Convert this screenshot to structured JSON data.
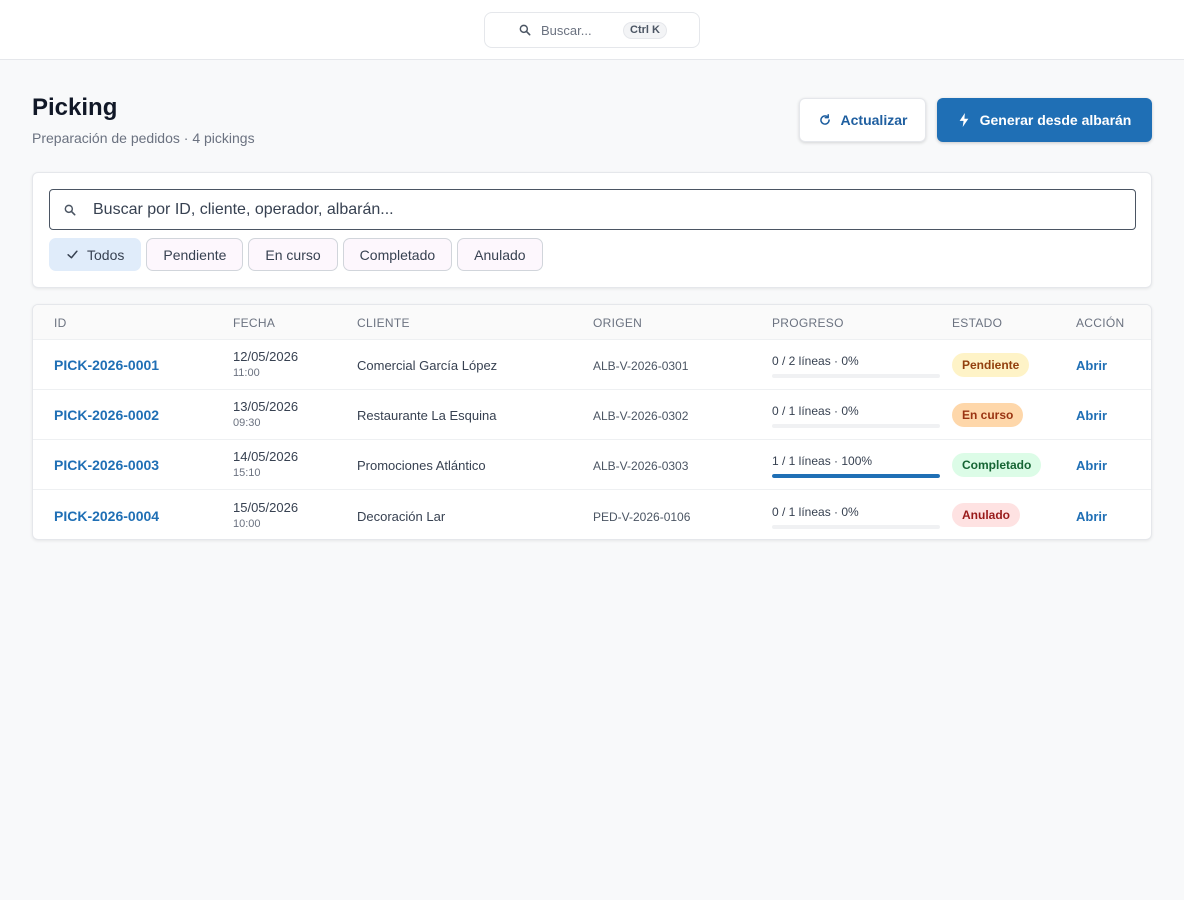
{
  "topbar": {
    "search_placeholder": "Buscar...",
    "shortcut": "Ctrl K"
  },
  "header": {
    "title": "Picking",
    "subtitle": "Preparación de pedidos · 4 pickings",
    "refresh_label": "Actualizar",
    "generate_label": "Generar desde albarán"
  },
  "filters": {
    "search_placeholder": "Buscar por ID, cliente, operador, albarán...",
    "chips": [
      {
        "label": "Todos",
        "active": true
      },
      {
        "label": "Pendiente",
        "active": false
      },
      {
        "label": "En curso",
        "active": false
      },
      {
        "label": "Completado",
        "active": false
      },
      {
        "label": "Anulado",
        "active": false
      }
    ]
  },
  "table": {
    "columns": [
      "ID",
      "FECHA",
      "CLIENTE",
      "ORIGEN",
      "PROGRESO",
      "ESTADO",
      "ACCIÓN"
    ],
    "rows": [
      {
        "id": "PICK-2026-0001",
        "date": "12/05/2026",
        "time": "11:00",
        "client": "Comercial García López",
        "origin": "ALB-V-2026-0301",
        "progress_text": "0 / 2 líneas · 0%",
        "progress": 0,
        "status": "Pendiente",
        "status_key": "pending",
        "action": "Abrir"
      },
      {
        "id": "PICK-2026-0002",
        "date": "13/05/2026",
        "time": "09:30",
        "client": "Restaurante La Esquina",
        "origin": "ALB-V-2026-0302",
        "progress_text": "0 / 1 líneas · 0%",
        "progress": 0,
        "status": "En curso",
        "status_key": "inprogress",
        "action": "Abrir"
      },
      {
        "id": "PICK-2026-0003",
        "date": "14/05/2026",
        "time": "15:10",
        "client": "Promociones Atlántico",
        "origin": "ALB-V-2026-0303",
        "progress_text": "1 / 1 líneas · 100%",
        "progress": 100,
        "status": "Completado",
        "status_key": "done",
        "action": "Abrir"
      },
      {
        "id": "PICK-2026-0004",
        "date": "15/05/2026",
        "time": "10:00",
        "client": "Decoración Lar",
        "origin": "PED-V-2026-0106",
        "progress_text": "0 / 1 líneas · 0%",
        "progress": 0,
        "status": "Anulado",
        "status_key": "cancelled",
        "action": "Abrir"
      }
    ]
  },
  "colors": {
    "primary": "#1f6fb5",
    "pending_bg": "#fef3c7",
    "pending_fg": "#92400e",
    "inprogress_bg": "#fed7aa",
    "inprogress_fg": "#9a3412",
    "done_bg": "#dcfce7",
    "done_fg": "#166534",
    "cancelled_bg": "#fee2e2",
    "cancelled_fg": "#991b1b"
  },
  "icons": {
    "topbar_search": "search-icon",
    "refresh": "refresh-icon",
    "generate": "bolt-icon",
    "filter_search": "search-icon",
    "active_chip": "check-icon"
  }
}
